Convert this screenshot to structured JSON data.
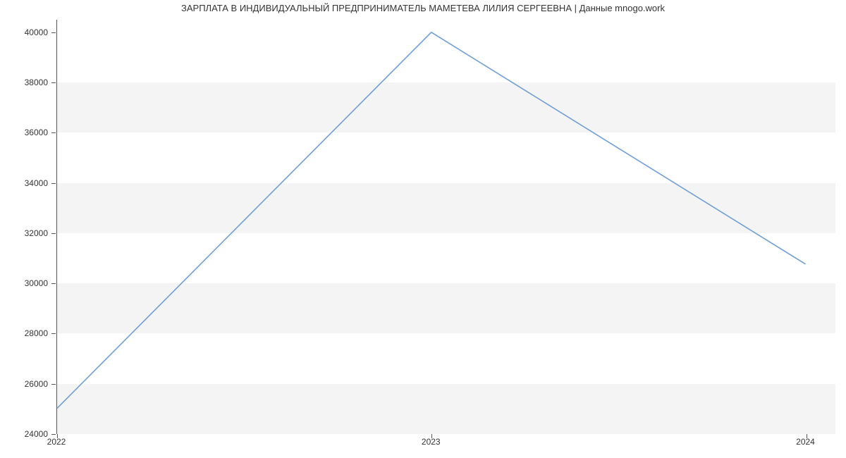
{
  "chart_data": {
    "type": "line",
    "title": "ЗАРПЛАТА В ИНДИВИДУАЛЬНЫЙ ПРЕДПРИНИМАТЕЛЬ МАМЕТЕВА ЛИЛИЯ СЕРГЕЕВНА | Данные mnogo.work",
    "x": [
      2022,
      2023,
      2024
    ],
    "values": [
      25000,
      40000,
      30750
    ],
    "xticks": [
      2022,
      2023,
      2024
    ],
    "yticks": [
      24000,
      26000,
      28000,
      30000,
      32000,
      34000,
      36000,
      38000,
      40000
    ],
    "xlim": [
      2022,
      2024.08
    ],
    "ylim": [
      24000,
      40500
    ],
    "grid_bands_y": [
      [
        24000,
        26000
      ],
      [
        28000,
        30000
      ],
      [
        32000,
        34000
      ],
      [
        36000,
        38000
      ]
    ],
    "line_color": "#6f9ed8"
  }
}
